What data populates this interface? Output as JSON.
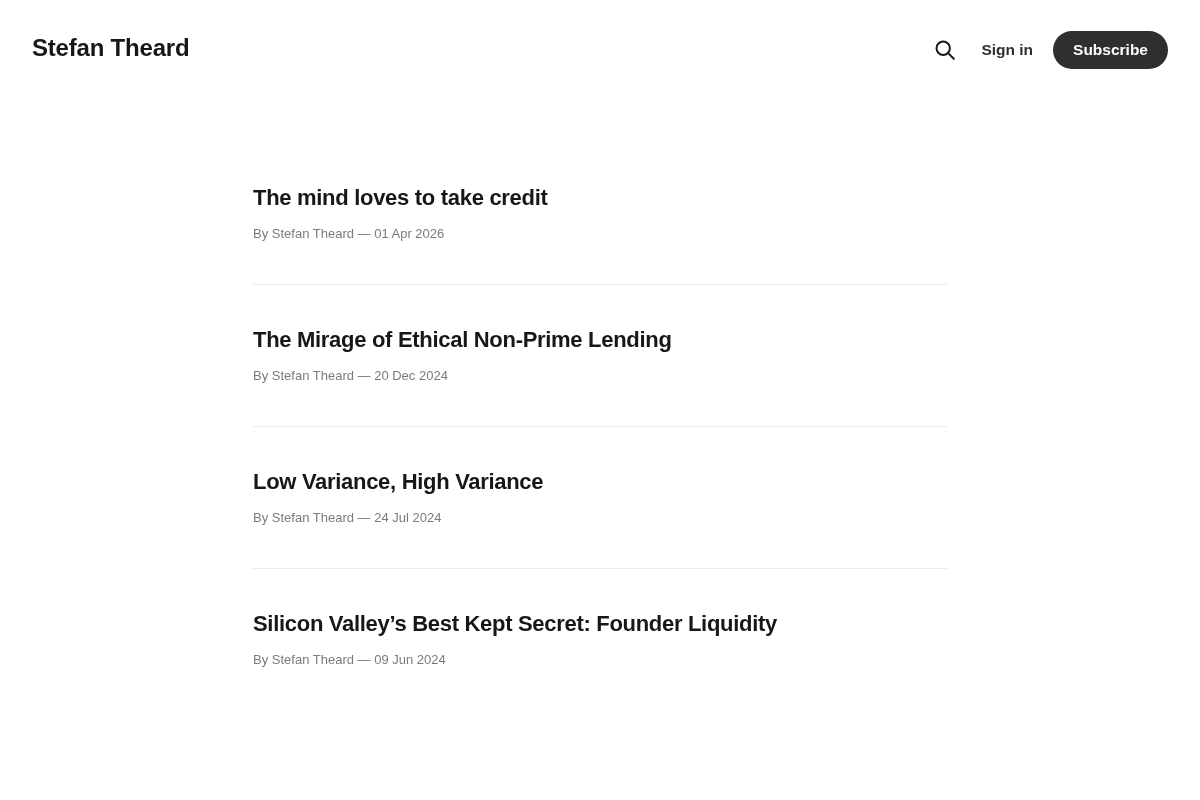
{
  "site": {
    "title": "Stefan Theard"
  },
  "header_actions": {
    "sign_in": "Sign in",
    "subscribe": "Subscribe"
  },
  "posts": [
    {
      "title": "The mind loves to take credit",
      "byline": "By Stefan Theard — 01 Apr 2026"
    },
    {
      "title": "The Mirage of Ethical Non-Prime Lending",
      "byline": "By Stefan Theard — 20 Dec 2024"
    },
    {
      "title": "Low Variance, High Variance",
      "byline": "By Stefan Theard — 24 Jul 2024"
    },
    {
      "title": "Silicon Valley’s Best Kept Secret: Founder Liquidity",
      "byline": "By Stefan Theard — 09 Jun 2024"
    }
  ]
}
